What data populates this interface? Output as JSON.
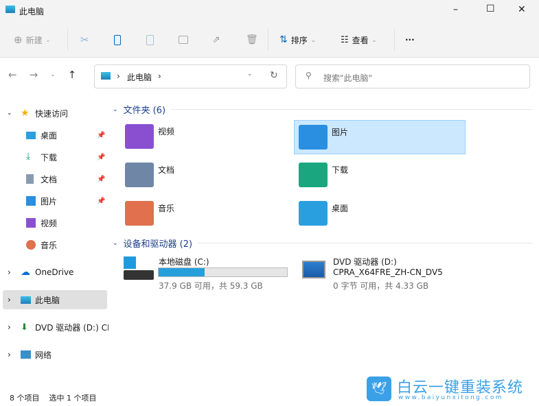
{
  "window": {
    "title": "此电脑",
    "minimize": "–",
    "maximize": "☐",
    "close": "✕"
  },
  "toolbar": {
    "new": "新建",
    "sort": "排序",
    "view": "查看",
    "more": "···"
  },
  "address": {
    "path": "此电脑",
    "search_placeholder": "搜索\"此电脑\""
  },
  "sidebar": {
    "quick_access": "快速访问",
    "quick_items": [
      {
        "label": "桌面",
        "pinned": true
      },
      {
        "label": "下载",
        "pinned": true
      },
      {
        "label": "文档",
        "pinned": true
      },
      {
        "label": "图片",
        "pinned": true
      },
      {
        "label": "视频",
        "pinned": false
      },
      {
        "label": "音乐",
        "pinned": false
      }
    ],
    "onedrive": "OneDrive",
    "this_pc": "此电脑",
    "dvd": "DVD 驱动器 (D:) CPRA",
    "network": "网络"
  },
  "folders": {
    "header": "文件夹 (6)",
    "items": [
      {
        "label": "视频",
        "color": "#8a4fd1"
      },
      {
        "label": "图片",
        "color": "#2a8fe0",
        "selected": true
      },
      {
        "label": "文档",
        "color": "#6f86a6"
      },
      {
        "label": "下载",
        "color": "#1aa77f"
      },
      {
        "label": "音乐",
        "color": "#e0704e"
      },
      {
        "label": "桌面",
        "color": "#2a9fe0"
      }
    ]
  },
  "devices": {
    "header": "设备和驱动器 (2)",
    "c": {
      "label": "本地磁盘 (C:)",
      "free": "37.9 GB 可用，共 59.3 GB",
      "used_fraction": 0.36
    },
    "d": {
      "label": "DVD 驱动器 (D:)",
      "volume": "CPRA_X64FRE_ZH-CN_DV5",
      "free": "0 字节 可用，共 4.33 GB"
    }
  },
  "status": {
    "count": "8 个项目",
    "selected": "选中 1 个项目"
  },
  "watermark": {
    "text": "白云一键重装系统",
    "url": "www.baiyunxitong.com"
  },
  "colors": {
    "accent": "#0067c0",
    "selection": "#cce8ff",
    "bar": "#26a0da"
  }
}
